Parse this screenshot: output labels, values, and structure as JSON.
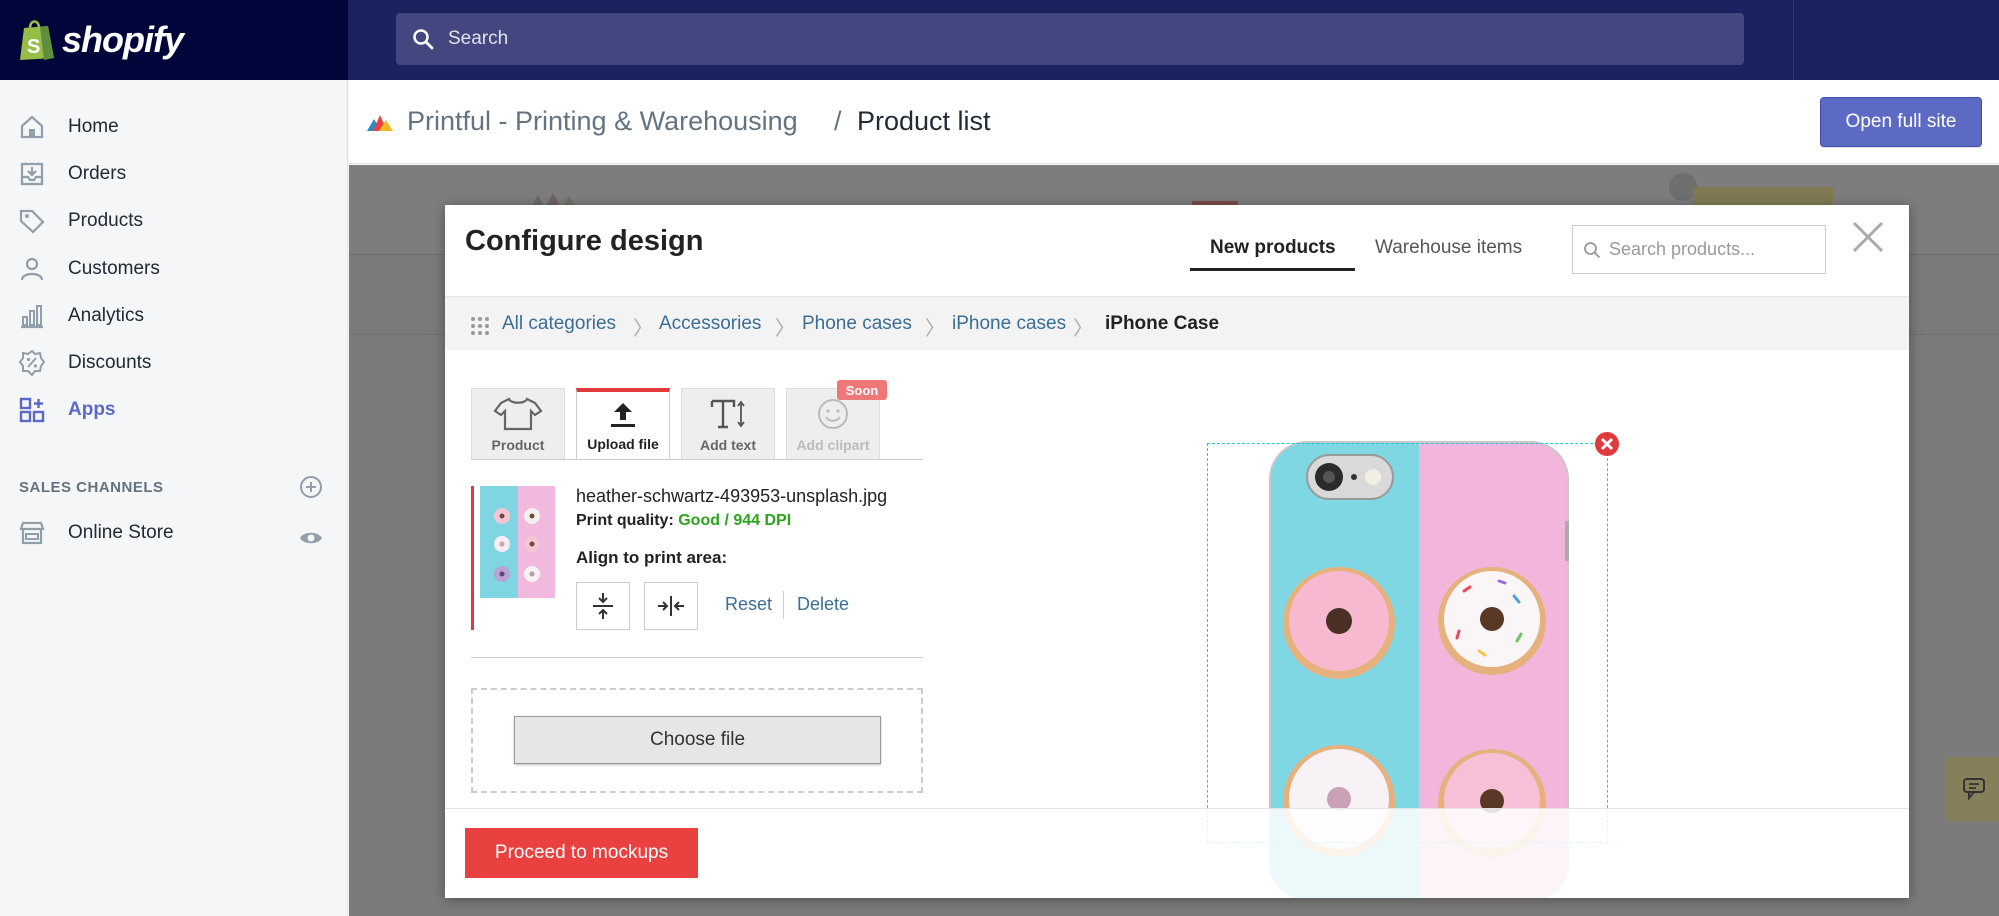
{
  "topbar": {
    "logo_text": "shopify",
    "search_placeholder": "Search"
  },
  "sidebar": {
    "items": [
      {
        "label": "Home",
        "icon": "home-icon"
      },
      {
        "label": "Orders",
        "icon": "orders-icon"
      },
      {
        "label": "Products",
        "icon": "tag-icon"
      },
      {
        "label": "Customers",
        "icon": "person-icon"
      },
      {
        "label": "Analytics",
        "icon": "bar-chart-icon"
      },
      {
        "label": "Discounts",
        "icon": "discount-icon"
      },
      {
        "label": "Apps",
        "icon": "apps-icon"
      }
    ],
    "section_title": "SALES CHANNELS",
    "channels": [
      {
        "label": "Online Store",
        "icon": "store-icon"
      }
    ]
  },
  "app_header": {
    "app_name": "Printful - Printing & Warehousing",
    "separator": "/",
    "current_page": "Product list",
    "open_full_site": "Open full site"
  },
  "modal": {
    "title": "Configure design",
    "tabs": [
      "New products",
      "Warehouse items"
    ],
    "active_tab": "New products",
    "search_placeholder": "Search products...",
    "breadcrumb": [
      "All categories",
      "Accessories",
      "Phone cases",
      "iPhone cases",
      "iPhone Case"
    ],
    "tools": [
      {
        "label": "Product",
        "icon": "tshirt-icon"
      },
      {
        "label": "Upload file",
        "icon": "upload-icon"
      },
      {
        "label": "Add text",
        "icon": "text-icon"
      },
      {
        "label": "Add clipart",
        "icon": "smiley-icon"
      }
    ],
    "soon_badge": "Soon",
    "file": {
      "name": "heather-schwartz-493953-unsplash.jpg",
      "quality_label": "Print quality:",
      "quality_value": "Good / 944 DPI",
      "align_label": "Align to print area:",
      "reset": "Reset",
      "delete": "Delete"
    },
    "choose_file": "Choose file",
    "proceed": "Proceed to mockups"
  },
  "colors": {
    "topbar": "#1c2260",
    "logo_bg": "#000639",
    "accent": "#5c6ac4",
    "printful_red": "#e8413f",
    "quality_good": "#27a71a",
    "print_area": "#26c6da"
  }
}
